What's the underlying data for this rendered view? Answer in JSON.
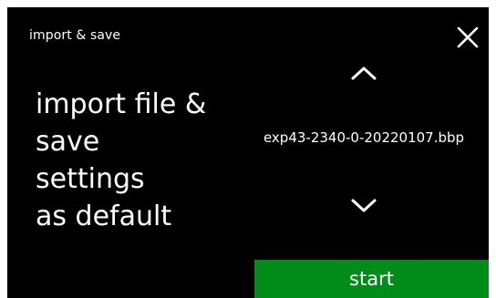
{
  "header": {
    "title": "import & save"
  },
  "description": {
    "lines": [
      "import file &",
      "save",
      "settings",
      "as default"
    ]
  },
  "file_selector": {
    "selected_file": "exp43-2340-0-20220107.bbp"
  },
  "actions": {
    "start_label": "start"
  },
  "icons": {
    "close": "close-icon",
    "up": "chevron-up-icon",
    "down": "chevron-down-icon"
  },
  "colors": {
    "background": "#000000",
    "text": "#ffffff",
    "start_button": "#008c18"
  }
}
